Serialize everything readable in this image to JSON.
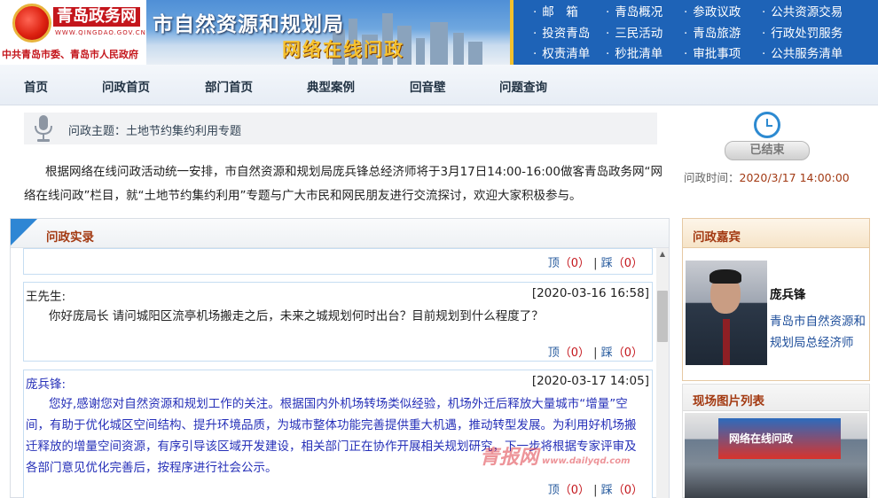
{
  "header": {
    "logo_name": "青岛政务网",
    "logo_url": "WWW.QINGDAO.GOV.CN",
    "logo_sub": "中共青岛市委、青岛市人民政府",
    "dept_title": "市自然资源和规划局",
    "sub_title": "网络在线问政",
    "top_links": [
      "邮　箱",
      "青岛概况",
      "参政议政",
      "公共资源交易",
      "投资青岛",
      "三民活动",
      "青岛旅游",
      "行政处罚服务",
      "权责清单",
      "秒批清单",
      "审批事项",
      "公共服务清单"
    ]
  },
  "nav": {
    "items": [
      "首页",
      "问政首页",
      "部门首页",
      "典型案例",
      "回音壁",
      "问题查询"
    ]
  },
  "topic": {
    "label": "问政主题：土地节约集约利用专题"
  },
  "intro": {
    "text": "根据网络在线问政活动统一安排，市自然资源和规划局庞兵锋总经济师将于3月17日14:00-16:00做客青岛政务网“网络在线问政”栏目，就“土地节约集约利用”专题与广大市民和网民朋友进行交流探讨，欢迎大家积极参与。"
  },
  "status": {
    "ended_label": "已结束",
    "time_label": "问政时间：",
    "time_value": "2020/3/17 14:00:00"
  },
  "record": {
    "title": "问政实录",
    "up_label": "顶",
    "down_label": "踩",
    "question": {
      "speaker": "王先生:",
      "timestamp": "[2020-03-16 16:58]",
      "text": "你好庞局长 请问城阳区流亭机场搬走之后，未来之城规划何时出台？目前规划到什么程度了？"
    },
    "answer": {
      "speaker": "庞兵锋:",
      "timestamp": "[2020-03-17 14:05]",
      "text": "您好,感谢您对自然资源和规划工作的关注。根据国内外机场转场类似经验，机场外迁后释放大量城市“增量”空间，有助于优化城区空间结构、提升环境品质，为城市整体功能完善提供重大机遇，推动转型发展。为利用好机场搬迁释放的增量空间资源，有序引导该区域开发建设，相关部门正在协作开展相关规划研究，下一步将根据专家评审及各部门意见优化完善后，按程序进行社会公示。"
    },
    "top_votes": {
      "up": "（0）",
      "down": "（0）"
    },
    "q_votes": {
      "up": "（0）",
      "down": "（0）"
    },
    "a_votes": {
      "up": "（0）",
      "down": "（0）"
    },
    "watermark": "青报网",
    "watermark_url": "www.dailyqd.com"
  },
  "guest": {
    "heading": "问政嘉宾",
    "name": "庞兵锋",
    "title": "青岛市自然资源和规划局总经济师"
  },
  "photos": {
    "heading": "现场图片列表",
    "screen_caption": "网络在线问政"
  }
}
